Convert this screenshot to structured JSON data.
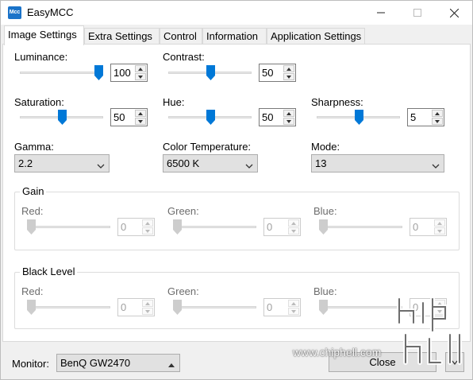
{
  "window": {
    "title": "EasyMCC",
    "icon_text": "Mcc"
  },
  "tabs": [
    {
      "label": "Image Settings",
      "active": true
    },
    {
      "label": "Extra Settings",
      "active": false
    },
    {
      "label": "Control",
      "active": false
    },
    {
      "label": "Information",
      "active": false
    },
    {
      "label": "Application Settings",
      "active": false
    }
  ],
  "image": {
    "luminance": {
      "label": "Luminance:",
      "value": "100",
      "level": 1.0
    },
    "contrast": {
      "label": "Contrast:",
      "value": "50",
      "level": 0.5
    },
    "saturation": {
      "label": "Saturation:",
      "value": "50",
      "level": 0.5
    },
    "hue": {
      "label": "Hue:",
      "value": "50",
      "level": 0.5
    },
    "sharpness": {
      "label": "Sharpness:",
      "value": "5",
      "level": 0.5
    },
    "gamma": {
      "label": "Gamma:",
      "value": "2.2"
    },
    "color_temperature": {
      "label": "Color Temperature:",
      "value": "6500 K"
    },
    "mode": {
      "label": "Mode:",
      "value": "13"
    }
  },
  "gain": {
    "title": "Gain",
    "red": {
      "label": "Red:",
      "value": "0",
      "level": 0
    },
    "green": {
      "label": "Green:",
      "value": "0",
      "level": 0
    },
    "blue": {
      "label": "Blue:",
      "value": "0",
      "level": 0
    }
  },
  "black_level": {
    "title": "Black Level",
    "red": {
      "label": "Red:",
      "value": "0",
      "level": 0
    },
    "green": {
      "label": "Green:",
      "value": "0",
      "level": 0
    },
    "blue": {
      "label": "Blue:",
      "value": "0",
      "level": 0
    }
  },
  "footer": {
    "monitor_label": "Monitor:",
    "monitor_value": "BenQ GW2470",
    "close_label": "Close"
  },
  "watermark": {
    "text": "www.chiphell.com"
  },
  "colors": {
    "accent": "#0078d7",
    "disabled": "#a0a0a0"
  }
}
